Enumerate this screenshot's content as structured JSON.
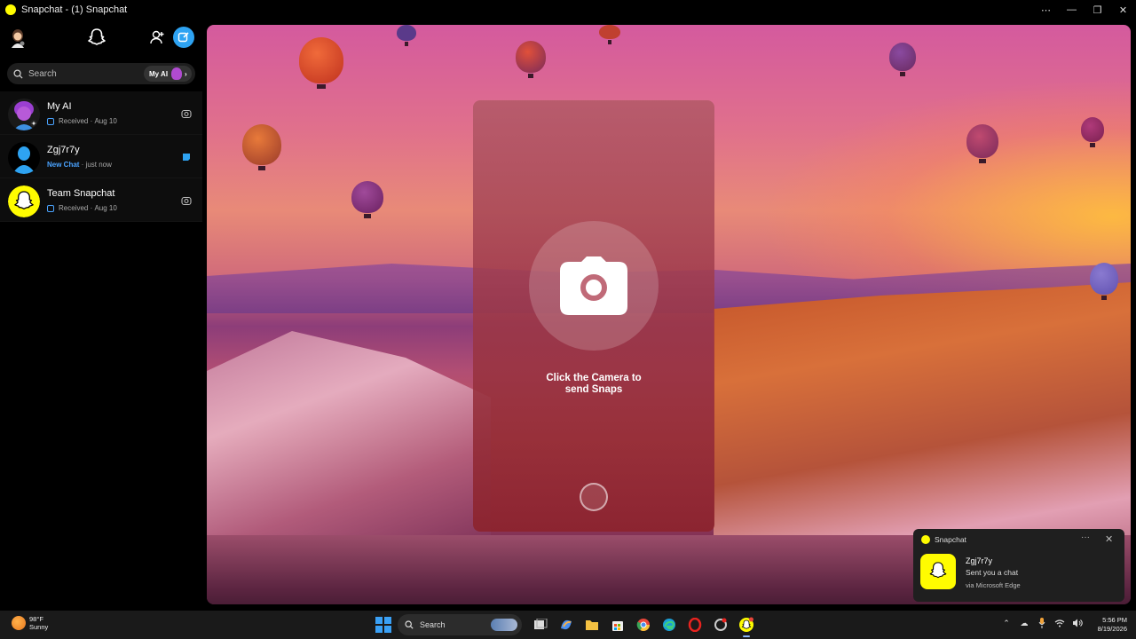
{
  "window": {
    "title": "Snapchat - (1) Snapchat",
    "controls": [
      "⋯",
      "—",
      "❐",
      "✕"
    ]
  },
  "sidebar": {
    "search_placeholder": "Search",
    "myai_pill_label": "My AI",
    "chats": [
      {
        "name": "My AI",
        "status_label": "Received",
        "time": "Aug 10",
        "status_type": "received",
        "avatar": "bitmoji-purple"
      },
      {
        "name": "Zgj7r7y",
        "status_label": "New Chat",
        "time": "just now",
        "status_type": "new",
        "avatar": "default-blue"
      },
      {
        "name": "Team Snapchat",
        "status_label": "Received",
        "time": "Aug 10",
        "status_type": "received",
        "avatar": "snapchat-ghost"
      }
    ]
  },
  "main": {
    "camera_prompt_line1": "Click the Camera to",
    "camera_prompt_line2": "send Snaps"
  },
  "notification": {
    "app": "Snapchat",
    "title": "Zgj7r7y",
    "body": "Sent you a chat",
    "via": "via Microsoft Edge"
  },
  "taskbar": {
    "weather_temp": "98°F",
    "weather_cond": "Sunny",
    "search_label": "Search",
    "time": "5:56 PM",
    "date": "8/19/2026"
  },
  "colors": {
    "snap_yellow": "#fffc00",
    "accent_blue": "#2ea3f2",
    "new_chat_blue": "#4aa3ff"
  }
}
